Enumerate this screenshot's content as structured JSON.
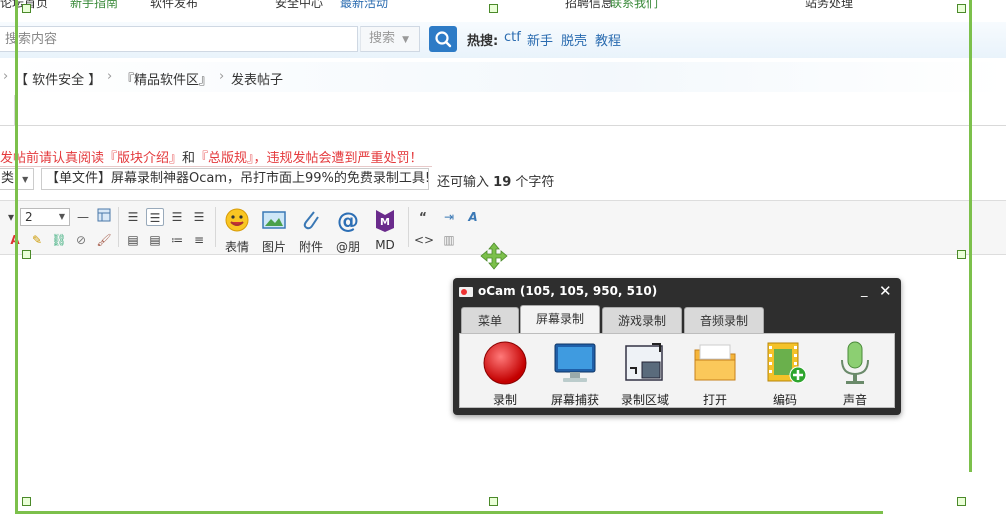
{
  "top_strip": {
    "items": [
      "论坛首页",
      "新手指南",
      "软件发布",
      "安全中心",
      "最新活动",
      "招聘信息",
      "联系我们",
      "站务处理"
    ]
  },
  "search": {
    "placeholder": "搜索内容",
    "type_label": "搜索",
    "hot_label": "热搜:",
    "hot_links": [
      "ctf",
      "新手",
      "脱壳",
      "教程"
    ]
  },
  "breadcrumb": {
    "items": [
      "【 软件安全 】",
      "『精品软件区』",
      "发表帖子"
    ]
  },
  "post_form": {
    "notice_part1": "发帖前请认真阅读『版块介绍』",
    "notice_and": "和",
    "notice_part2": "『总版规』",
    "notice_part3": "，违规发帖会遭到严重处罚！",
    "category_value": "类",
    "title_value": "【单文件】屏幕录制神器Ocam，吊打市面上99%的免费录制工具!",
    "remain_prefix": "还可输入",
    "remain_count": "19",
    "remain_suffix": "个字符"
  },
  "toolbar": {
    "font_size": "2",
    "big_buttons": [
      "表情",
      "图片",
      "附件",
      "@朋",
      "MD"
    ]
  },
  "ocam": {
    "title": "oCam (105, 105, 950, 510)",
    "minimize": "_",
    "close": "✕",
    "tabs": [
      "菜单",
      "屏幕录制",
      "游戏录制",
      "音频录制"
    ],
    "active_tab": "屏幕录制",
    "buttons": [
      "录制",
      "屏幕捕获",
      "录制区域",
      "打开",
      "编码",
      "声音"
    ]
  },
  "colors": {
    "selection_frame": "#7cc04b",
    "link": "#2b6cb0",
    "notice_red": "#e4393c",
    "search_button": "#2d7bc6",
    "ocam_bg": "#2e2e2e"
  }
}
